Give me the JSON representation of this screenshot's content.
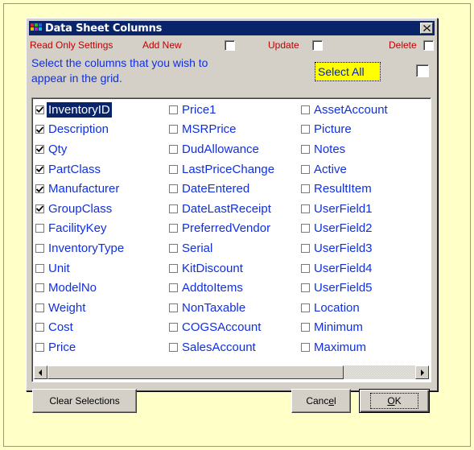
{
  "dialog": {
    "title": "Data Sheet Columns",
    "close_label": "x"
  },
  "settings_row": {
    "read_only_label": "Read Only Settings",
    "add_new_label": "Add New",
    "update_label": "Update",
    "delete_label": "Delete"
  },
  "instructions": {
    "line1": "Select the columns that you wish to",
    "line2": "appear in the grid."
  },
  "select_all": {
    "label": "Select All",
    "checked": false
  },
  "columns_list": {
    "selected_item": "InventoryID",
    "col1": [
      {
        "label": "InventoryID",
        "checked": true
      },
      {
        "label": "Description",
        "checked": true
      },
      {
        "label": "Qty",
        "checked": true
      },
      {
        "label": "PartClass",
        "checked": true
      },
      {
        "label": "Manufacturer",
        "checked": true
      },
      {
        "label": "GroupClass",
        "checked": true
      },
      {
        "label": "FacilityKey",
        "checked": false
      },
      {
        "label": "InventoryType",
        "checked": false
      },
      {
        "label": "Unit",
        "checked": false
      },
      {
        "label": "ModelNo",
        "checked": false
      },
      {
        "label": "Weight",
        "checked": false
      },
      {
        "label": "Cost",
        "checked": false
      },
      {
        "label": "Price",
        "checked": false
      }
    ],
    "col2": [
      {
        "label": "Price1",
        "checked": false
      },
      {
        "label": "MSRPrice",
        "checked": false
      },
      {
        "label": "DudAllowance",
        "checked": false
      },
      {
        "label": "LastPriceChange",
        "checked": false
      },
      {
        "label": "DateEntered",
        "checked": false
      },
      {
        "label": "DateLastReceipt",
        "checked": false
      },
      {
        "label": "PreferredVendor",
        "checked": false
      },
      {
        "label": "Serial",
        "checked": false
      },
      {
        "label": "KitDiscount",
        "checked": false
      },
      {
        "label": "AddtoItems",
        "checked": false
      },
      {
        "label": "NonTaxable",
        "checked": false
      },
      {
        "label": "COGSAccount",
        "checked": false
      },
      {
        "label": "SalesAccount",
        "checked": false
      }
    ],
    "col3": [
      {
        "label": "AssetAccount",
        "checked": false
      },
      {
        "label": "Picture",
        "checked": false
      },
      {
        "label": "Notes",
        "checked": false
      },
      {
        "label": "Active",
        "checked": false
      },
      {
        "label": "ResultItem",
        "checked": false
      },
      {
        "label": "UserField1",
        "checked": false
      },
      {
        "label": "UserField2",
        "checked": false
      },
      {
        "label": "UserField3",
        "checked": false
      },
      {
        "label": "UserField4",
        "checked": false
      },
      {
        "label": "UserField5",
        "checked": false
      },
      {
        "label": "Location",
        "checked": false
      },
      {
        "label": "Minimum",
        "checked": false
      },
      {
        "label": "Maximum",
        "checked": false
      }
    ]
  },
  "buttons": {
    "clear_selections": "Clear Selections",
    "cancel_pre": "Canc",
    "cancel_ul": "e",
    "cancel_post": "l",
    "ok_ul": "O",
    "ok_post": "K"
  },
  "colors": {
    "background": "#FFFFC8",
    "titlebar": "#0A246A",
    "list_text": "#1030E0",
    "settings_text": "#C00000",
    "select_all_highlight": "#FFFF00"
  }
}
